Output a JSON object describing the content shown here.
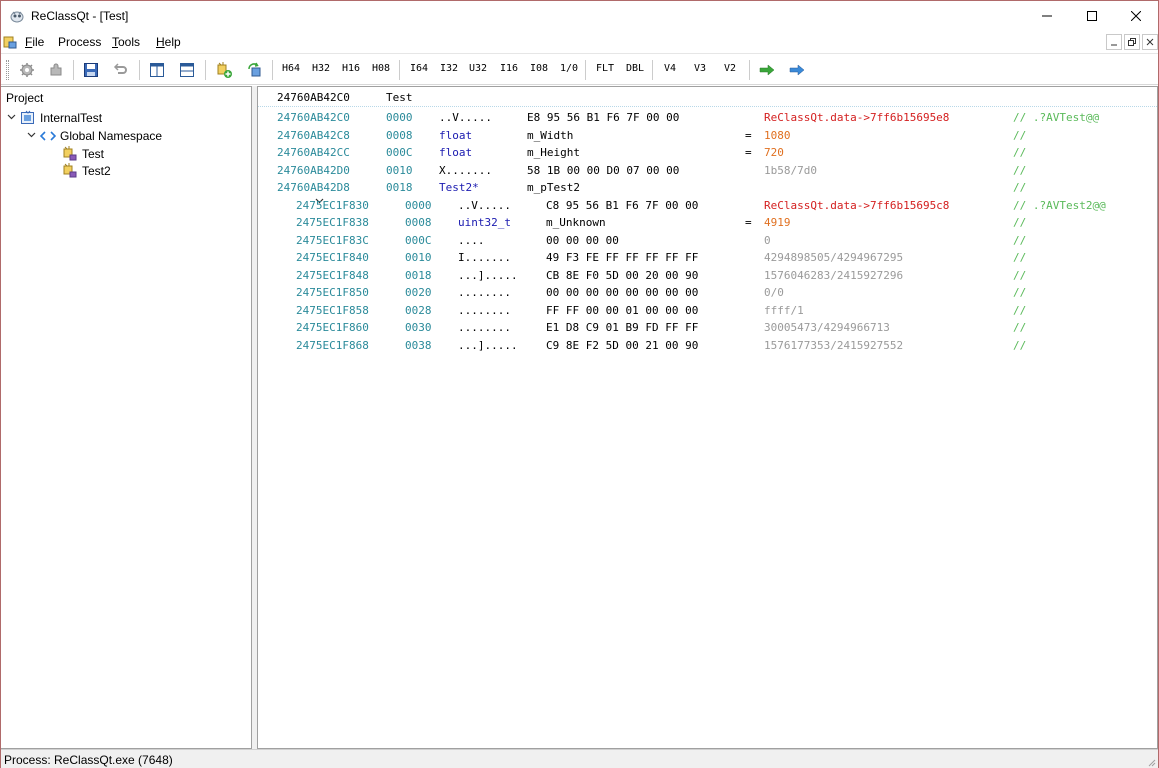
{
  "window": {
    "title": "ReClassQt - [Test]"
  },
  "menu": {
    "items": [
      {
        "label": "File",
        "u": "F",
        "rest": "ile"
      },
      {
        "label": "Process",
        "u": "",
        "rest": "Process"
      },
      {
        "label": "Tools",
        "u": "T",
        "rest": "ools"
      },
      {
        "label": "Help",
        "u": "H",
        "rest": "elp"
      }
    ]
  },
  "toolbar": {
    "icons": [
      "settings-icon",
      "plugin-icon",
      "save-icon",
      "undo-icon",
      "split-vertical-icon",
      "split-horizontal-icon",
      "add-class-icon",
      "refresh-class-icon"
    ],
    "type_buttons": [
      "H64",
      "H32",
      "H16",
      "H08",
      "I64",
      "I32",
      "U32",
      "I16",
      "I08",
      "1/0",
      "FLT",
      "DBL",
      "V4",
      "V3",
      "V2"
    ],
    "colors": {
      "arrow_green": "#3aa63a",
      "arrow_blue": "#3a8ad8"
    }
  },
  "project": {
    "title": "Project",
    "tree": [
      {
        "label": "InternalTest",
        "level": 0,
        "expanded": true,
        "icon": "project-icon"
      },
      {
        "label": "Global Namespace",
        "level": 1,
        "expanded": true,
        "icon": "namespace-icon"
      },
      {
        "label": "Test",
        "level": 2,
        "icon": "class-icon"
      },
      {
        "label": "Test2",
        "level": 2,
        "icon": "class-icon"
      }
    ]
  },
  "memory": {
    "header": {
      "address": "24760AB42C0",
      "class_name": "Test"
    },
    "rows": [
      {
        "addr": "24760AB42C0",
        "off": "0000",
        "kind": "ascii",
        "ascii": "..V.....",
        "hex": "E8 95 56 B1 F6 7F 00 00",
        "value": "ReClassQt.data->7ff6b15695e8",
        "value_style": "ptr",
        "comment": "// .?AVTest@@"
      },
      {
        "addr": "24760AB42C8",
        "off": "0008",
        "kind": "typed",
        "type": "float",
        "name": "m_Width",
        "eq": "=",
        "value": "1080",
        "value_style": "val",
        "comment": "//"
      },
      {
        "addr": "24760AB42CC",
        "off": "000C",
        "kind": "typed",
        "type": "float",
        "name": "m_Height",
        "eq": "=",
        "value": "720",
        "value_style": "val",
        "comment": "//"
      },
      {
        "addr": "24760AB42D0",
        "off": "0010",
        "kind": "ascii",
        "ascii": "X.......",
        "hex": "58 1B 00 00 D0 07 00 00",
        "value": "1b58/7d0",
        "value_style": "gray",
        "comment": "//"
      },
      {
        "addr": "24760AB42D8",
        "off": "0018",
        "kind": "pointer",
        "type": "Test2*",
        "name": "m_pTest2",
        "expanded": true,
        "comment": "//"
      },
      {
        "addr": "2475EC1F830",
        "off": "0000",
        "kind": "ascii",
        "indent": true,
        "ascii": "..V.....",
        "hex": "C8 95 56 B1 F6 7F 00 00",
        "value": "ReClassQt.data->7ff6b15695c8",
        "value_style": "ptr",
        "comment": "// .?AVTest2@@"
      },
      {
        "addr": "2475EC1F838",
        "off": "0008",
        "kind": "typed",
        "indent": true,
        "type": "uint32_t",
        "name": "m_Unknown",
        "eq": "=",
        "value": "4919",
        "value_style": "val",
        "comment": "//"
      },
      {
        "addr": "2475EC1F83C",
        "off": "000C",
        "kind": "ascii",
        "indent": true,
        "ascii": "....",
        "hex": "00 00 00 00",
        "value": "0",
        "value_style": "gray",
        "comment": "//"
      },
      {
        "addr": "2475EC1F840",
        "off": "0010",
        "kind": "ascii",
        "indent": true,
        "ascii": "I.......",
        "hex": "49 F3 FE FF FF FF FF FF",
        "value": "4294898505/4294967295",
        "value_style": "gray",
        "comment": "//"
      },
      {
        "addr": "2475EC1F848",
        "off": "0018",
        "kind": "ascii",
        "indent": true,
        "ascii": "...].....",
        "hex": "CB 8E F0 5D 00 20 00 90",
        "value": "1576046283/2415927296",
        "value_style": "gray",
        "comment": "//"
      },
      {
        "addr": "2475EC1F850",
        "off": "0020",
        "kind": "ascii",
        "indent": true,
        "ascii": "........",
        "hex": "00 00 00 00 00 00 00 00",
        "value": "0/0",
        "value_style": "gray",
        "comment": "//"
      },
      {
        "addr": "2475EC1F858",
        "off": "0028",
        "kind": "ascii",
        "indent": true,
        "ascii": "........",
        "hex": "FF FF 00 00 01 00 00 00",
        "value": "ffff/1",
        "value_style": "gray",
        "comment": "//"
      },
      {
        "addr": "2475EC1F860",
        "off": "0030",
        "kind": "ascii",
        "indent": true,
        "ascii": "........",
        "hex": "E1 D8 C9 01 B9 FD FF FF",
        "value": "30005473/4294966713",
        "value_style": "gray",
        "comment": "//"
      },
      {
        "addr": "2475EC1F868",
        "off": "0038",
        "kind": "ascii",
        "indent": true,
        "ascii": "...].....",
        "hex": "C9 8E F2 5D 00 21 00 90",
        "value": "1576177353/2415927552",
        "value_style": "gray",
        "comment": "//"
      }
    ]
  },
  "status": {
    "text": "Process: ReClassQt.exe (7648)"
  }
}
